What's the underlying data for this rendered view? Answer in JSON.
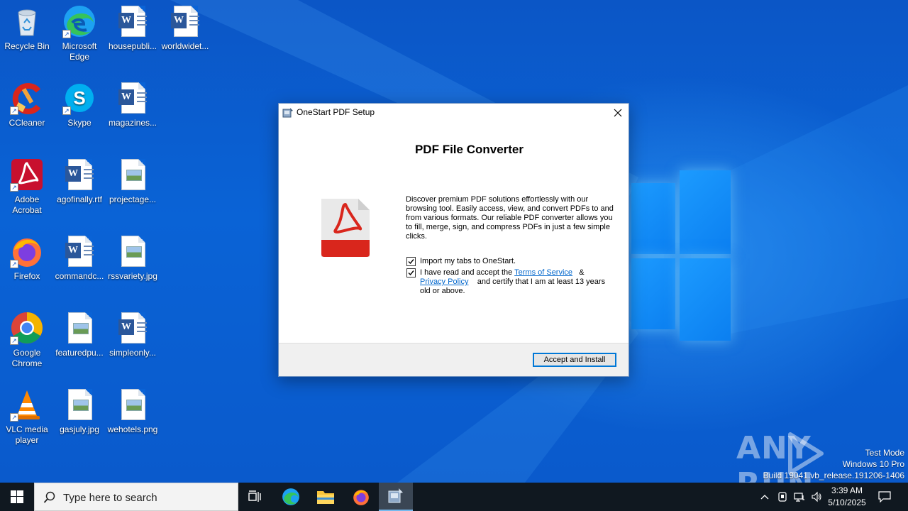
{
  "desktop": {
    "icons": [
      {
        "label": "Recycle Bin"
      },
      {
        "label": "Microsoft Edge"
      },
      {
        "label": "housepubli..."
      },
      {
        "label": "worldwidet..."
      },
      {
        "label": "CCleaner"
      },
      {
        "label": "Skype"
      },
      {
        "label": "magazines..."
      },
      {
        "label": "Adobe Acrobat"
      },
      {
        "label": "agofinally.rtf"
      },
      {
        "label": "projectage..."
      },
      {
        "label": "Firefox"
      },
      {
        "label": "commandc..."
      },
      {
        "label": "rssvariety.jpg"
      },
      {
        "label": "Google Chrome"
      },
      {
        "label": "featuredpu..."
      },
      {
        "label": "simpleonly..."
      },
      {
        "label": "VLC media player"
      },
      {
        "label": "gasjuly.jpg"
      },
      {
        "label": "wehotels.png"
      }
    ]
  },
  "dialog": {
    "title": "OneStart PDF Setup",
    "heading": "PDF File Converter",
    "description": "Discover premium PDF solutions effortlessly with our browsing tool. Easily access, view, and convert PDFs to and from various formats. Our reliable PDF converter allows you to fill, merge, sign, and compress PDFs in just a few simple clicks.",
    "import_tabs_label": "Import my tabs to OneStart.",
    "import_tabs_checked": true,
    "accept_prefix": "I have read and accept the",
    "terms_link": "Terms of Service",
    "ampersand": "&",
    "privacy_link": "Privacy Policy",
    "accept_suffix": "and certify that I am at least 13 years old or above.",
    "accept_checked": true,
    "accept_button": "Accept and Install"
  },
  "watermark": {
    "brand_left": "ANY",
    "brand_right": "RUN"
  },
  "os_info": {
    "line1": "Test Mode",
    "line2": "Windows 10 Pro",
    "line3": "Build 19041.vb_release.191206-1406"
  },
  "taskbar": {
    "search_placeholder": "Type here to search",
    "time": "3:39 AM",
    "date": "5/10/2025"
  },
  "colors": {
    "desktop_blue": "#0a63d6",
    "taskbar": "#101820",
    "accent": "#0078d7",
    "link": "#0066cc"
  }
}
